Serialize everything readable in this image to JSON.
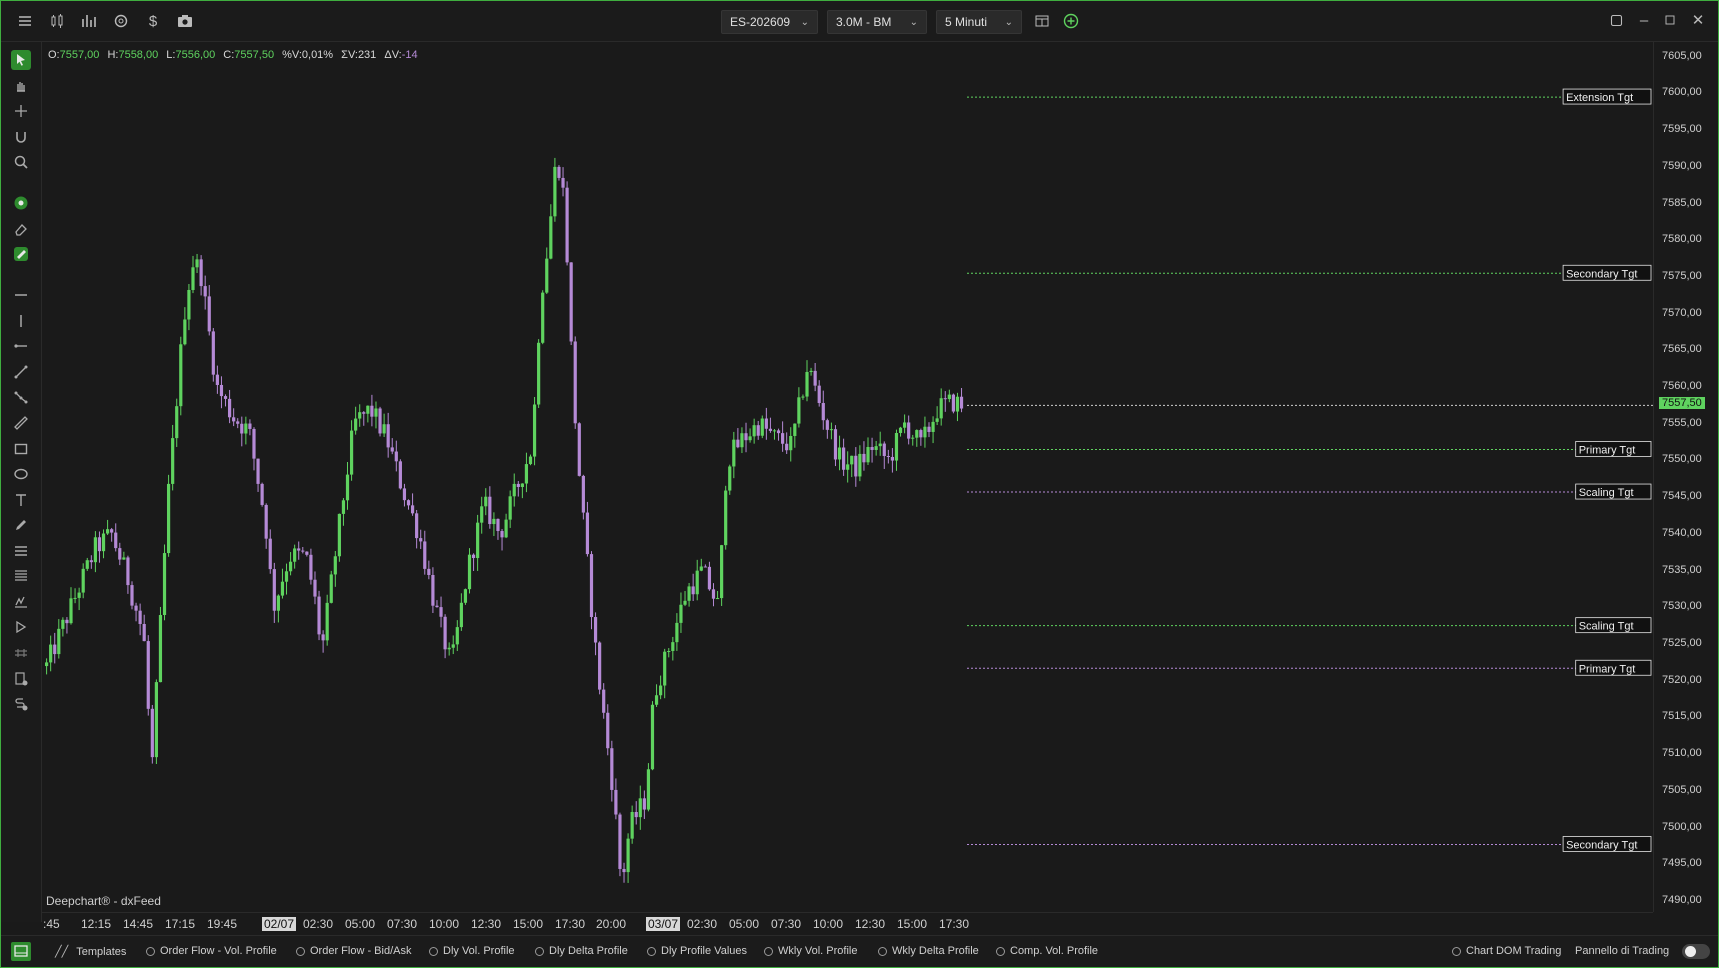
{
  "topbar": {
    "symbol": "ES-202609",
    "bar_type": "3.0M - BM",
    "timeframe": "5 Minuti"
  },
  "ohlc": {
    "o_label": "O:",
    "o": "7557,00",
    "h_label": "H:",
    "h": "7558,00",
    "l_label": "L:",
    "l": "7556,00",
    "c_label": "C:",
    "c": "7557,50",
    "pctv": "%V:0,01%",
    "sumv": "ΣV:231",
    "dv_label": "ΔV:",
    "dv": "-14"
  },
  "watermark": "Deepchart® - dxFeed",
  "price_axis": [
    "7605,00",
    "7600,00",
    "7595,00",
    "7590,00",
    "7585,00",
    "7580,00",
    "7575,00",
    "7570,00",
    "7565,00",
    "7560,00",
    "7555,00",
    "7550,00",
    "7545,00",
    "7540,00",
    "7535,00",
    "7530,00",
    "7525,00",
    "7520,00",
    "7515,00",
    "7510,00",
    "7505,00",
    "7500,00",
    "7495,00",
    "7490,00"
  ],
  "time_axis": [
    {
      "label": ":45",
      "boxed": false
    },
    {
      "label": "12:15",
      "boxed": false
    },
    {
      "label": "14:45",
      "boxed": false
    },
    {
      "label": "17:15",
      "boxed": false
    },
    {
      "label": "19:45",
      "boxed": false
    },
    {
      "label": "02/07",
      "boxed": true
    },
    {
      "label": "02:30",
      "boxed": false
    },
    {
      "label": "05:00",
      "boxed": false
    },
    {
      "label": "07:30",
      "boxed": false
    },
    {
      "label": "10:00",
      "boxed": false
    },
    {
      "label": "12:30",
      "boxed": false
    },
    {
      "label": "15:00",
      "boxed": false
    },
    {
      "label": "17:30",
      "boxed": false
    },
    {
      "label": "20:00",
      "boxed": false
    },
    {
      "label": "03/07",
      "boxed": true
    },
    {
      "label": "02:30",
      "boxed": false
    },
    {
      "label": "05:00",
      "boxed": false
    },
    {
      "label": "07:30",
      "boxed": false
    },
    {
      "label": "10:00",
      "boxed": false
    },
    {
      "label": "12:30",
      "boxed": false
    },
    {
      "label": "15:00",
      "boxed": false
    },
    {
      "label": "17:30",
      "boxed": false
    }
  ],
  "current_price": "7557,50",
  "targets": [
    {
      "label": "Extension Tgt",
      "price": 7599.5,
      "color": "#5fd35f"
    },
    {
      "label": "Secondary Tgt",
      "price": 7575.5,
      "color": "#5fd35f"
    },
    {
      "label": "Primary Tgt",
      "price": 7551.5,
      "color": "#5fd35f"
    },
    {
      "label": "Scaling Tgt",
      "price": 7545.7,
      "color": "#b58ad6"
    },
    {
      "label": "Scaling Tgt",
      "price": 7527.5,
      "color": "#5fd35f"
    },
    {
      "label": "Primary Tgt",
      "price": 7521.7,
      "color": "#b58ad6"
    },
    {
      "label": "Secondary Tgt",
      "price": 7497.7,
      "color": "#b58ad6"
    }
  ],
  "chart_data": {
    "type": "candlestick",
    "y_range": [
      7488.5,
      7607.0
    ],
    "up_color": "#5fd35f",
    "down_color": "#b58ad6",
    "close_path": [
      [
        0,
        7522
      ],
      [
        3,
        7530
      ],
      [
        6,
        7538
      ],
      [
        8,
        7540
      ],
      [
        10,
        7534
      ],
      [
        12,
        7526
      ],
      [
        13,
        7508
      ],
      [
        15,
        7545
      ],
      [
        17,
        7570
      ],
      [
        18,
        7577
      ],
      [
        19,
        7576
      ],
      [
        21,
        7560
      ],
      [
        23,
        7556
      ],
      [
        25,
        7554
      ],
      [
        27,
        7542
      ],
      [
        28,
        7530
      ],
      [
        30,
        7537
      ],
      [
        32,
        7537
      ],
      [
        33,
        7532
      ],
      [
        34,
        7524
      ],
      [
        36,
        7540
      ],
      [
        38,
        7555
      ],
      [
        40,
        7557
      ],
      [
        42,
        7553
      ],
      [
        44,
        7546
      ],
      [
        46,
        7540
      ],
      [
        48,
        7530
      ],
      [
        50,
        7522
      ],
      [
        52,
        7535
      ],
      [
        54,
        7544
      ],
      [
        56,
        7540
      ],
      [
        58,
        7546
      ],
      [
        60,
        7552
      ],
      [
        61,
        7572
      ],
      [
        62,
        7580
      ],
      [
        63,
        7592
      ],
      [
        64,
        7585
      ],
      [
        65,
        7560
      ],
      [
        66,
        7545
      ],
      [
        68,
        7522
      ],
      [
        70,
        7505
      ],
      [
        71,
        7492
      ],
      [
        72,
        7500
      ],
      [
        74,
        7504
      ],
      [
        75,
        7518
      ],
      [
        77,
        7525
      ],
      [
        79,
        7532
      ],
      [
        81,
        7535
      ],
      [
        83,
        7530
      ],
      [
        84,
        7550
      ],
      [
        86,
        7553
      ],
      [
        88,
        7555
      ],
      [
        90,
        7553
      ],
      [
        92,
        7552
      ],
      [
        94,
        7563
      ],
      [
        96,
        7556
      ],
      [
        98,
        7550
      ],
      [
        100,
        7549
      ],
      [
        102,
        7552
      ],
      [
        104,
        7550
      ],
      [
        106,
        7555
      ],
      [
        108,
        7552
      ],
      [
        110,
        7557
      ],
      [
        112,
        7558
      ],
      [
        113,
        7557.5
      ]
    ]
  },
  "bottombar": {
    "templates": "Templates",
    "items": [
      "Order Flow - Vol. Profile",
      "Order Flow - Bid/Ask",
      "Dly Vol. Profile",
      "Dly Delta Profile",
      "Dly Profile Values",
      "Wkly Vol. Profile",
      "Wkly Delta Profile",
      "Comp. Vol. Profile"
    ],
    "chart_dom": "Chart DOM Trading",
    "panel": "Pannello di Trading"
  }
}
